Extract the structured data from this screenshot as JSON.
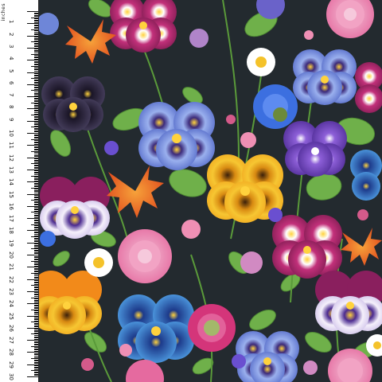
{
  "ruler": {
    "unit_label": "inches",
    "numbers": [
      "1",
      "2",
      "3",
      "4",
      "5",
      "6",
      "7",
      "8",
      "9",
      "10",
      "11",
      "12",
      "13",
      "14",
      "15",
      "16",
      "17",
      "18",
      "19",
      "20",
      "21",
      "22",
      "23",
      "24",
      "25",
      "26",
      "27",
      "28",
      "29",
      "30"
    ]
  },
  "colors": {
    "background": "#232a2f",
    "ruler": "#ffffff",
    "pansy_pink": "#c2307a",
    "pansy_blue": "#6e86d8",
    "pansy_purple": "#6b3fb5",
    "pansy_yellow": "#f1b320",
    "leaf": "#6fb04a",
    "chrysanthemum_orange": "#ee6a2a",
    "dahlia_pink": "#ef86b3",
    "cornflower": "#3c6fe0"
  },
  "flowers": [
    {
      "name": "pansy",
      "color": "pansy_pink"
    },
    {
      "name": "pansy",
      "color": "pansy_blue"
    },
    {
      "name": "pansy",
      "color": "pansy_purple"
    },
    {
      "name": "pansy",
      "color": "pansy_yellow"
    },
    {
      "name": "chrysanthemum",
      "color": "chrysanthemum_orange"
    },
    {
      "name": "dahlia",
      "color": "dahlia_pink"
    },
    {
      "name": "cornflower",
      "color": "cornflower"
    },
    {
      "name": "daisy",
      "color": "#ffffff"
    }
  ]
}
